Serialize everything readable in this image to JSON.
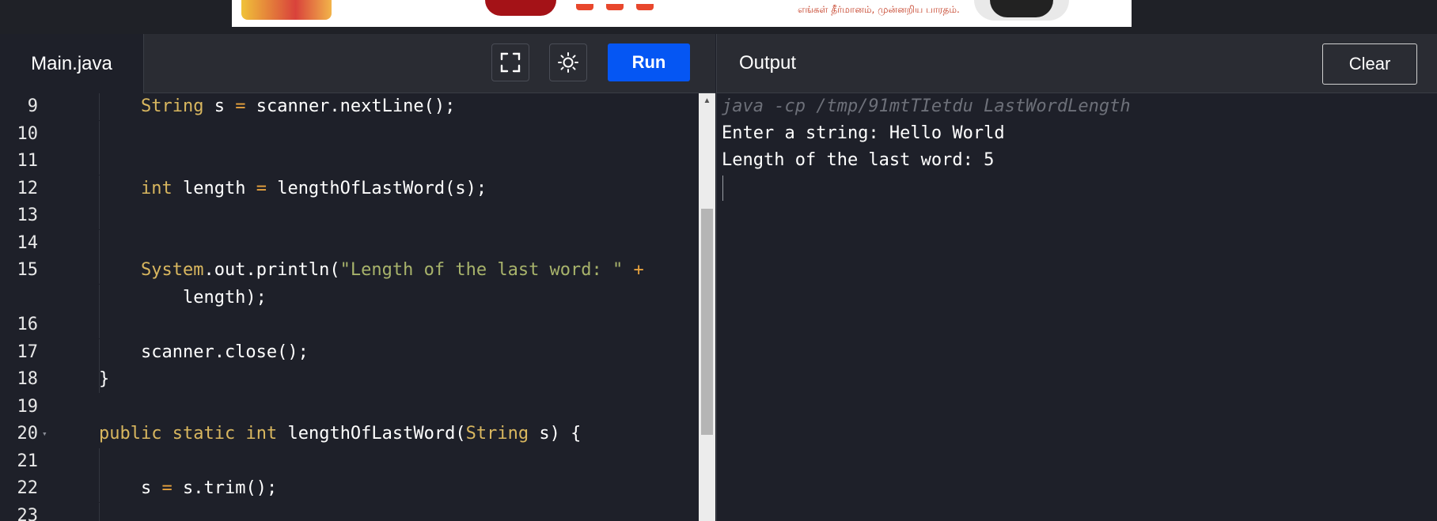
{
  "ad": {
    "tamil_text": "எங்கள் தீர்மானம், முன்னறிய பாரதம்."
  },
  "editor": {
    "tab_label": "Main.java",
    "run_label": "Run",
    "lines": [
      {
        "num": "9",
        "tokens": [
          [
            "",
            "    "
          ],
          [
            "kw",
            "String"
          ],
          [
            "",
            " s "
          ],
          [
            "op",
            "="
          ],
          [
            "",
            " scanner.nextLine();"
          ]
        ]
      },
      {
        "num": "10",
        "tokens": []
      },
      {
        "num": "11",
        "tokens": []
      },
      {
        "num": "12",
        "tokens": [
          [
            "",
            "    "
          ],
          [
            "kw",
            "int"
          ],
          [
            "",
            " length "
          ],
          [
            "op",
            "="
          ],
          [
            "",
            " lengthOfLastWord(s);"
          ]
        ]
      },
      {
        "num": "13",
        "tokens": []
      },
      {
        "num": "14",
        "tokens": []
      },
      {
        "num": "15",
        "tokens": [
          [
            "",
            "    "
          ],
          [
            "kw",
            "System"
          ],
          [
            "",
            ".out.println("
          ],
          [
            "str",
            "\"Length of the last word: \""
          ],
          [
            "",
            " "
          ],
          [
            "op",
            "+"
          ]
        ]
      },
      {
        "num": "",
        "tokens": [
          [
            "",
            "        length);"
          ]
        ]
      },
      {
        "num": "16",
        "tokens": []
      },
      {
        "num": "17",
        "tokens": [
          [
            "",
            "    scanner.close();"
          ]
        ]
      },
      {
        "num": "18",
        "tokens": [
          [
            "",
            "}"
          ]
        ]
      },
      {
        "num": "19",
        "tokens": []
      },
      {
        "num": "20",
        "fold": "▾",
        "tokens": [
          [
            "kw",
            "public"
          ],
          [
            "",
            " "
          ],
          [
            "kw",
            "static"
          ],
          [
            "",
            " "
          ],
          [
            "kw",
            "int"
          ],
          [
            "",
            " lengthOfLastWord("
          ],
          [
            "kw",
            "String"
          ],
          [
            "",
            " s) {"
          ]
        ]
      },
      {
        "num": "21",
        "tokens": []
      },
      {
        "num": "22",
        "tokens": [
          [
            "",
            "    s "
          ],
          [
            "op",
            "="
          ],
          [
            "",
            " s.trim();"
          ]
        ]
      },
      {
        "num": "23",
        "tokens": []
      }
    ]
  },
  "output": {
    "title": "Output",
    "clear_label": "Clear",
    "command": "java -cp /tmp/91mtTIetdu LastWordLength",
    "lines": [
      "Enter a string: Hello World",
      "Length of the last word: 5"
    ]
  }
}
